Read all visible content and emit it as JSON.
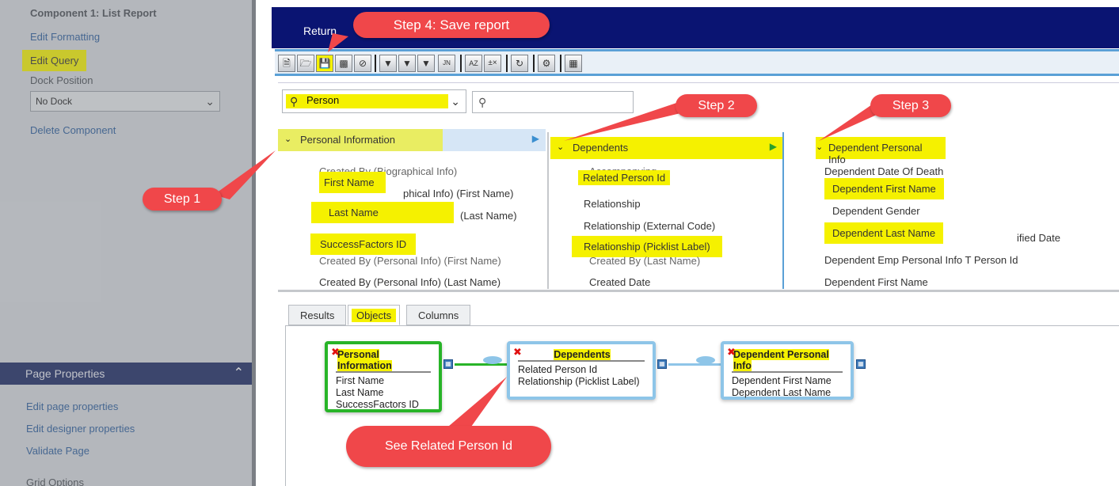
{
  "left": {
    "title": "Component 1: List Report",
    "edit_formatting": "Edit Formatting",
    "edit_query": "Edit Query",
    "dock_position_label": "Dock Position",
    "dock_position_value": "No Dock",
    "delete_component": "Delete Component",
    "page_properties": "Page Properties",
    "edit_page_properties": "Edit page properties",
    "edit_designer_properties": "Edit designer properties",
    "validate_page": "Validate Page",
    "grid_options": "Grid Options"
  },
  "header": {
    "return_label": "Return"
  },
  "search": {
    "query": "Person"
  },
  "columns": {
    "col1": {
      "header": "Personal Information",
      "items": [
        "Created By (Biographical Info)",
        "First Name",
        "phical Info) (First Name)",
        "Last Name",
        "(Last Name)",
        "SuccessFactors ID",
        "Created By (Personal Info) (First Name)",
        "Created By (Personal Info) (Last Name)"
      ]
    },
    "col2": {
      "header": "Dependents",
      "items": [
        "Accompanying",
        "Related Person Id",
        "Relationship",
        "Relationship (External Code)",
        "Relationship (Picklist Label)",
        "Created By (Last Name)",
        "Created Date"
      ]
    },
    "col3": {
      "header": "Dependent Personal Info",
      "items": [
        "Dependent Date Of Death",
        "Dependent First Name",
        "Dependent Gender",
        "Dependent Last Name",
        "ified Date",
        "Dependent Emp Personal Info T Person Id",
        "Dependent First Name"
      ]
    }
  },
  "tabs": [
    "Results",
    "Objects",
    "Columns"
  ],
  "objects": [
    {
      "title": "Personal Information",
      "fields": [
        "First Name",
        "Last Name",
        "SuccessFactors ID"
      ]
    },
    {
      "title": "Dependents",
      "fields": [
        "Related Person Id",
        "Relationship (Picklist Label)"
      ]
    },
    {
      "title": "Dependent Personal Info",
      "fields": [
        "Dependent First Name",
        "Dependent Last Name"
      ]
    }
  ],
  "callouts": {
    "step1": "Step 1",
    "step2": "Step 2",
    "step3": "Step 3",
    "step4": "Step 4: Save report",
    "related": "See Related Person Id"
  },
  "colors": {
    "header_bg": "#0a1472",
    "highlight": "#f5f100",
    "callout": "#f0474a",
    "accent_blue": "#5aa0d6"
  }
}
